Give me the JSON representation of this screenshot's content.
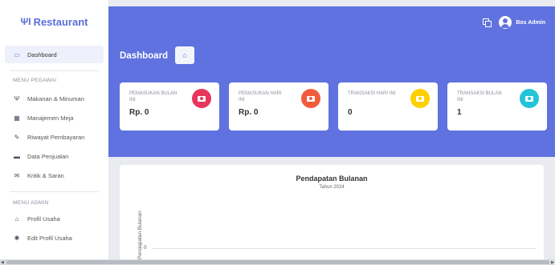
{
  "brand": {
    "icon": "utensils-icon",
    "name": "Restaurant"
  },
  "sidebar": {
    "dashboard": {
      "label": "Dashboard",
      "icon": "monitor-icon"
    },
    "section_pegawai": "MENU PEGAWAI",
    "items_pegawai": [
      {
        "label": "Makanan & Minuman",
        "icon": "utensils-icon"
      },
      {
        "label": "Manajemen Meja",
        "icon": "table-icon"
      },
      {
        "label": "Riwayat Pembayaran",
        "icon": "edit-icon"
      },
      {
        "label": "Data Penjualan",
        "icon": "money-icon"
      },
      {
        "label": "Kritik & Saran",
        "icon": "envelope-icon"
      }
    ],
    "section_admin": "MENU ADMIN",
    "items_admin": [
      {
        "label": "Profil Usaha",
        "icon": "home-icon"
      },
      {
        "label": "Edit Profil Usaha",
        "icon": "gear-icon"
      }
    ]
  },
  "header": {
    "user": "Bos Admin",
    "page_title": "Dashboard"
  },
  "cards": [
    {
      "label": "PEMASUKAN BULAN INI",
      "value": "Rp. 0",
      "color": "#e8365d"
    },
    {
      "label": "PEMASUKAN HARI INI",
      "value": "Rp. 0",
      "color": "#f25c3b"
    },
    {
      "label": "TRANSAKSI HARI INI",
      "value": "0",
      "color": "#ffd000"
    },
    {
      "label": "TRANSAKSI BULAN INI",
      "value": "1",
      "color": "#23c4d8"
    }
  ],
  "chart_data": {
    "type": "line",
    "title": "Pendapatan Bulanan",
    "subtitle": "Tahun 2024",
    "ylabel": "Pendapatan Bulanan",
    "yticks": [
      "0"
    ],
    "series": []
  }
}
